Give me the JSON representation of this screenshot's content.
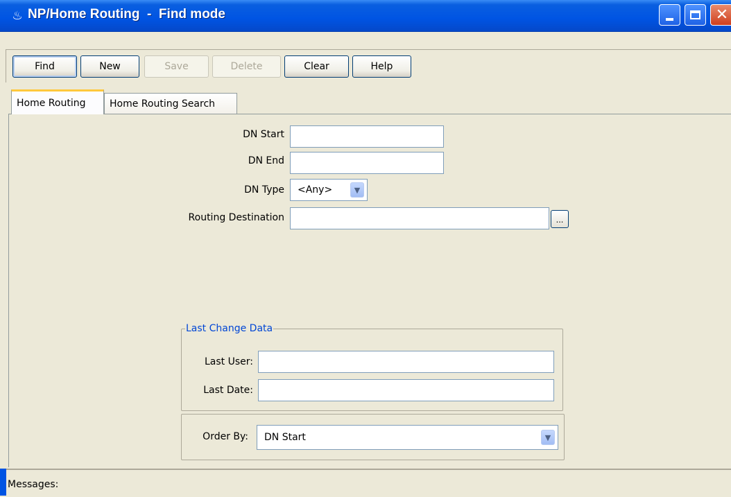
{
  "window": {
    "title": "NP/Home Routing  -  Find mode",
    "icon": "java-cup-icon"
  },
  "toolbar": {
    "find_label": "Find",
    "new_label": "New",
    "save_label": "Save",
    "delete_label": "Delete",
    "clear_label": "Clear",
    "help_label": "Help"
  },
  "tabs": [
    {
      "label": "Home Routing",
      "active": true
    },
    {
      "label": "Home Routing Search",
      "active": false
    }
  ],
  "form": {
    "dn_start_label": "DN Start",
    "dn_start_value": "",
    "dn_end_label": "DN End",
    "dn_end_value": "",
    "dn_type_label": "DN Type",
    "dn_type_value": "<Any>",
    "routing_destination_label": "Routing Destination",
    "routing_destination_value": "",
    "browse_label": "..."
  },
  "last_change": {
    "title": "Last Change Data",
    "last_user_label": "Last User:",
    "last_user_value": "",
    "last_date_label": "Last Date:",
    "last_date_value": ""
  },
  "order_by": {
    "label": "Order By:",
    "value": "DN Start"
  },
  "messages": {
    "label": "Messages:"
  },
  "colors": {
    "titlebar": "#0054e3",
    "background": "#ece9d8",
    "group_title": "#0046d5",
    "active_tab_accent": "#ffc83c"
  }
}
